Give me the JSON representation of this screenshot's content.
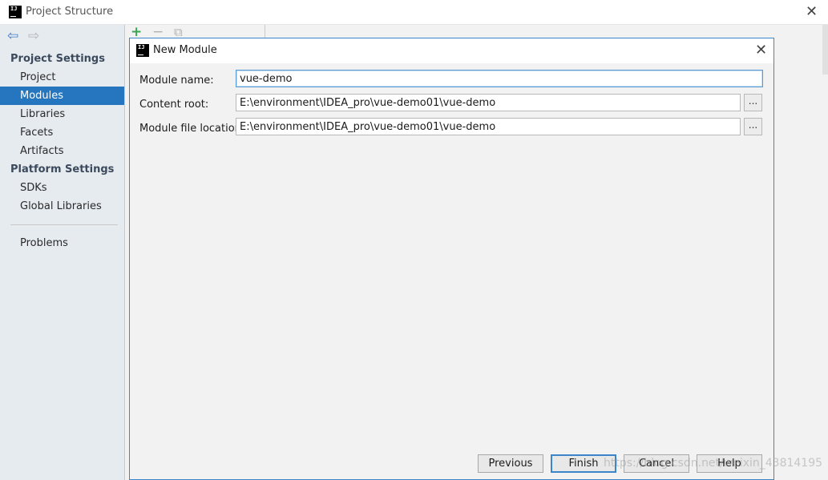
{
  "window": {
    "title": "Project Structure",
    "close_glyph": "✕",
    "icon_text": "IJ"
  },
  "toolbar": {
    "back_glyph": "⇦",
    "forward_glyph": "⇨",
    "add_glyph": "+",
    "remove_glyph": "−",
    "copy_glyph": "⧉"
  },
  "sidebar": {
    "project_settings_label": "Project Settings",
    "project_settings_items": [
      {
        "label": "Project",
        "selected": false
      },
      {
        "label": "Modules",
        "selected": true
      },
      {
        "label": "Libraries",
        "selected": false
      },
      {
        "label": "Facets",
        "selected": false
      },
      {
        "label": "Artifacts",
        "selected": false
      }
    ],
    "platform_settings_label": "Platform Settings",
    "platform_settings_items": [
      {
        "label": "SDKs"
      },
      {
        "label": "Global Libraries"
      }
    ],
    "problems_label": "Problems"
  },
  "dialog": {
    "title": "New Module",
    "close_glyph": "✕",
    "icon_text": "IJ",
    "module_name_label": "Module name:",
    "module_name_value": "vue-demo",
    "content_root_label": "Content root:",
    "content_root_value": "E:\\environment\\IDEA_pro\\vue-demo01\\vue-demo",
    "module_file_location_label": "Module file location:",
    "module_file_location_value": "E:\\environment\\IDEA_pro\\vue-demo01\\vue-demo",
    "browse_label": "...",
    "buttons": {
      "previous": "Previous",
      "finish": "Finish",
      "cancel": "Cancel",
      "help": "Help"
    }
  },
  "watermark": "https://blog.csdn.net/weixin_43814195",
  "colors": {
    "accent": "#2675bf",
    "dialog_border": "#3a86c8",
    "add_green": "#3aa655"
  }
}
